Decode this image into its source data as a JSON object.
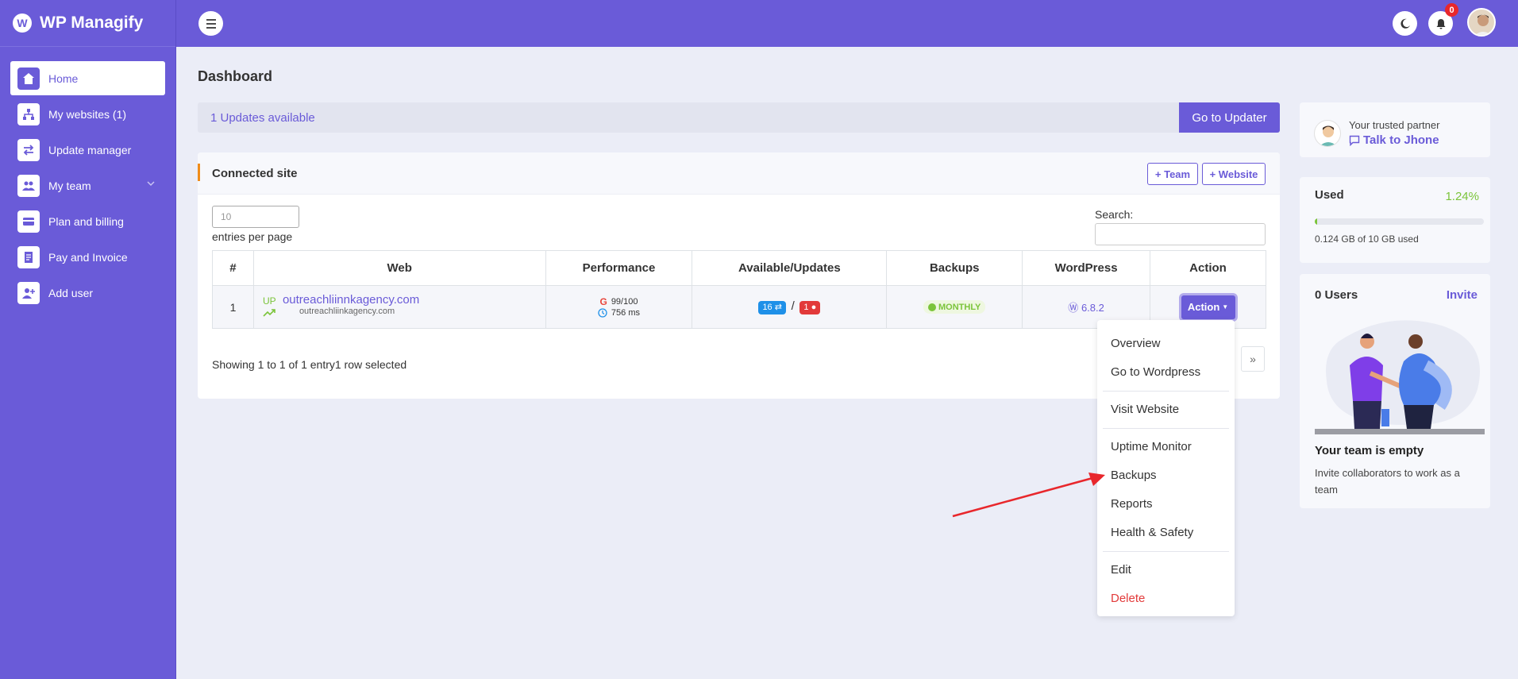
{
  "brand": {
    "name": "WP Managify",
    "logo_icon": "wordpress-logo-icon"
  },
  "sidebar": {
    "items": [
      {
        "label": "Home",
        "icon": "home-icon",
        "active": true
      },
      {
        "label": "My websites (1)",
        "icon": "sitemap-icon"
      },
      {
        "label": "Update manager",
        "icon": "arrows-exchange-icon"
      },
      {
        "label": "My team",
        "icon": "users-icon",
        "has_chevron": true
      },
      {
        "label": "Plan and billing",
        "icon": "credit-card-icon"
      },
      {
        "label": "Pay and Invoice",
        "icon": "invoice-icon"
      },
      {
        "label": "Add user",
        "icon": "user-plus-icon"
      }
    ]
  },
  "topbar": {
    "notification_count": "0"
  },
  "page": {
    "title": "Dashboard"
  },
  "updates": {
    "text": "1 Updates available",
    "button": "Go to Updater"
  },
  "connected": {
    "title": "Connected site",
    "team_button": "+ Team",
    "website_button": "+ Website",
    "entries_value": "10",
    "entries_label": "entries per page",
    "search_label": "Search:",
    "columns": [
      "#",
      "Web",
      "Performance",
      "Available/Updates",
      "Backups",
      "WordPress",
      "Action"
    ],
    "row": {
      "index": "1",
      "status": "UP",
      "site_name": "outreachliinnkagency.com",
      "site_sub": "outreachliinkagency.com",
      "score": "99/100",
      "load_time": "756 ms",
      "available": "16",
      "updates": "1",
      "backup": "MONTHLY",
      "wp_version": "6.8.2",
      "action": "Action"
    },
    "showing": "Showing 1 to 1 of 1 entry1 row selected",
    "next_page": "»"
  },
  "action_menu": {
    "items": [
      "Overview",
      "Go to Wordpress",
      "Visit Website",
      "Uptime Monitor",
      "Backups",
      "Reports",
      "Health & Safety",
      "Edit",
      "Delete"
    ]
  },
  "partner": {
    "caption": "Your trusted partner",
    "link": "Talk to Jhone"
  },
  "storage": {
    "title": "Used",
    "percent": "1.24%",
    "detail": "0.124 GB of 10 GB used",
    "fraction": 0.0124
  },
  "team": {
    "title": "0 Users",
    "invite": "Invite",
    "empty_title": "Your team is empty",
    "empty_text": "Invite collaborators to work as a team"
  },
  "colors": {
    "primary": "#6a5bd8",
    "accent_orange": "#f08c1a",
    "success": "#7bc43a",
    "danger": "#e23a3a",
    "info": "#1e90e8"
  }
}
